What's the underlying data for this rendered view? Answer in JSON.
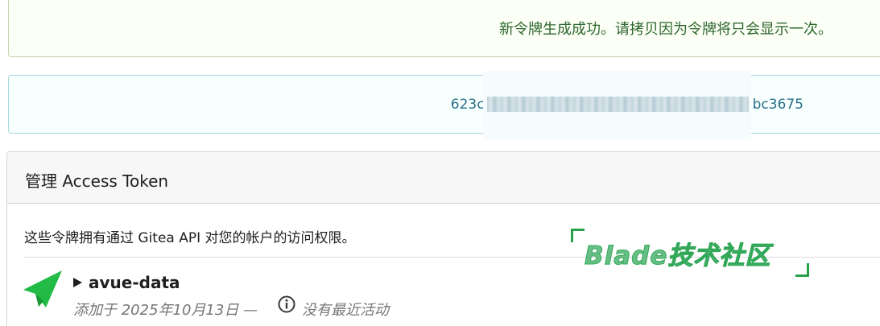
{
  "success_message": "新令牌生成成功。请拷贝因为令牌将只会显示一次。",
  "token_value_start": "623c",
  "token_value_end": "bc3675",
  "panel": {
    "title": "管理 Access Token",
    "description": "这些令牌拥有通过 Gitea API 对您的帐户的访问权限。"
  },
  "token_item": {
    "icon": "send-icon",
    "name": "avue-data",
    "added_text": "添加于 2025年10月13日 —",
    "activity_icon": "info-icon",
    "activity_text": "没有最近活动"
  },
  "watermark": "Blade技术社区",
  "colors": {
    "success_text": "#2c662d",
    "token_text": "#276f86",
    "icon_green": "#21ba45",
    "watermark_green": "#27a24a"
  }
}
